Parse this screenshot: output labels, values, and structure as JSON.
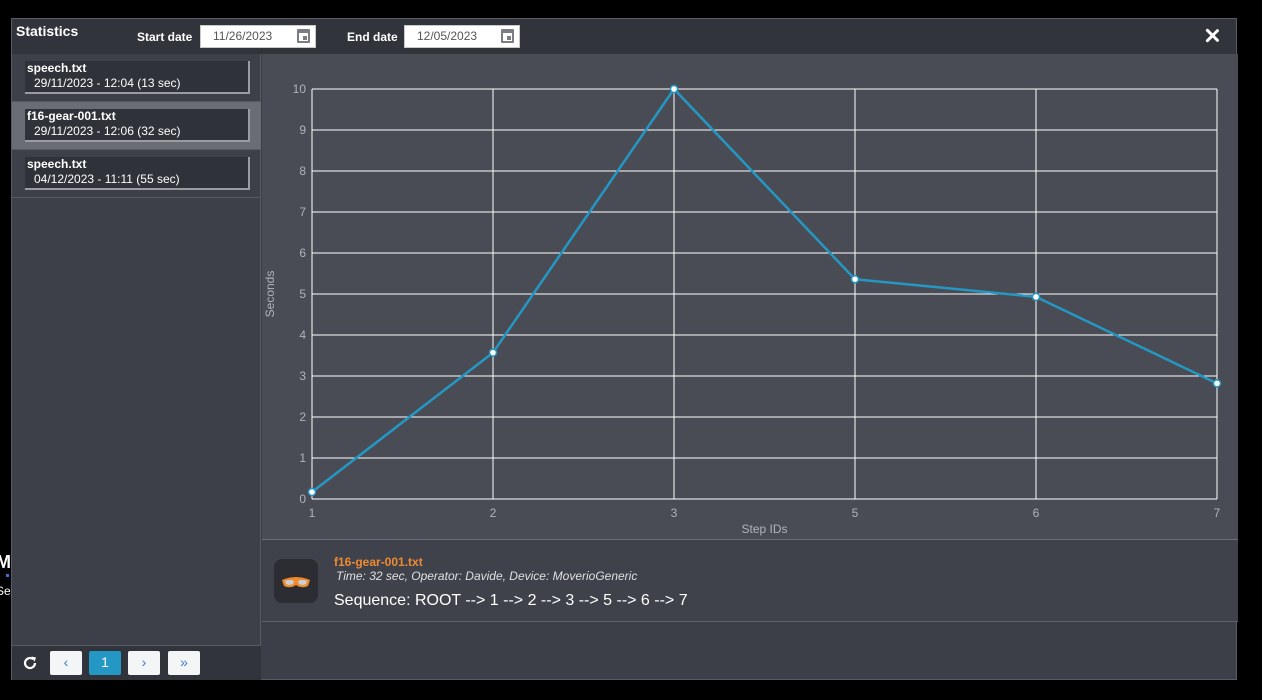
{
  "window": {
    "title": "Statistics"
  },
  "filters": {
    "start_label": "Start date",
    "start_value": "11/26/2023",
    "end_label": "End date",
    "end_value": "12/05/2023"
  },
  "sessions": [
    {
      "filename": "speech.txt",
      "datetime": "29/11/2023 - 12:04 (13 sec)",
      "selected": false
    },
    {
      "filename": "f16-gear-001.txt",
      "datetime": "29/11/2023 - 12:06 (32 sec)",
      "selected": true
    },
    {
      "filename": "speech.txt",
      "datetime": "04/12/2023 - 11:11 (55 sec)",
      "selected": false
    }
  ],
  "pagination": {
    "prev": "‹",
    "current": "1",
    "next": "›",
    "last": "»"
  },
  "details": {
    "filename": "f16-gear-001.txt",
    "meta": "Time: 32 sec, Operator: Davide, Device: MoverioGeneric",
    "sequence": "Sequence: ROOT --> 1 --> 2 --> 3 --> 5 --> 6 --> 7"
  },
  "background": {
    "peek_letter": "M",
    "peek_text": "Se"
  },
  "colors": {
    "line": "#2497c4",
    "accent": "#ef8a32",
    "page_active": "#2497c4"
  },
  "chart_data": {
    "type": "line",
    "xlabel": "Step IDs",
    "ylabel": "Seconds",
    "categories": [
      "1",
      "2",
      "3",
      "5",
      "6",
      "7"
    ],
    "series": [
      {
        "values": [
          0.17,
          3.57,
          10.0,
          5.36,
          4.93,
          2.82
        ]
      }
    ],
    "ylim": [
      0,
      10
    ],
    "yticks": [
      0,
      1,
      2,
      3,
      4,
      5,
      6,
      7,
      8,
      9,
      10
    ],
    "grid": true,
    "legend": "none"
  }
}
